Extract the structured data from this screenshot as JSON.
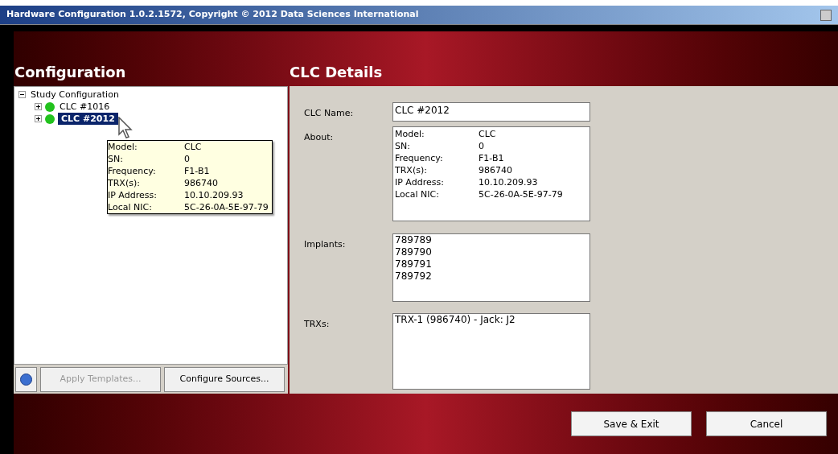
{
  "window": {
    "title": "Hardware Configuration 1.0.2.1572, Copyright © 2012 Data Sciences International"
  },
  "left_panel": {
    "heading": "Configuration",
    "tree": [
      {
        "label": "Study Configuration",
        "expanded": true,
        "selected": false,
        "children": [
          {
            "label": "CLC #1016",
            "expanded": false,
            "selected": false,
            "color": "#22c21e"
          },
          {
            "label": "CLC #2012",
            "expanded": false,
            "selected": true,
            "color": "#22c21e"
          }
        ]
      }
    ],
    "tooltip": [
      {
        "label": "Model:",
        "value": "CLC"
      },
      {
        "label": "SN:",
        "value": "0"
      },
      {
        "label": "Frequency:",
        "value": "F1-B1"
      },
      {
        "label": "TRX(s):",
        "value": "986740"
      },
      {
        "label": "IP Address:",
        "value": "10.10.209.93"
      },
      {
        "label": "Local NIC:",
        "value": "5C-26-0A-5E-97-79"
      }
    ],
    "buttons": [
      {
        "label": "Apply Templates...",
        "disabled": true
      },
      {
        "label": "Configure Sources...",
        "disabled": false
      }
    ]
  },
  "details": {
    "heading": "CLC Details",
    "name_label": "CLC Name:",
    "name_value": "CLC #2012",
    "about_label": "About:",
    "about": [
      {
        "label": "Model:",
        "value": "CLC"
      },
      {
        "label": "SN:",
        "value": "0"
      },
      {
        "label": "Frequency:",
        "value": "F1-B1"
      },
      {
        "label": "TRX(s):",
        "value": "986740"
      },
      {
        "label": "IP Address:",
        "value": "10.10.209.93"
      },
      {
        "label": "Local NIC:",
        "value": "5C-26-0A-5E-97-79"
      }
    ],
    "implants_label": "Implants:",
    "implants": [
      "789789",
      "789790",
      "789791",
      "789792"
    ],
    "trxs_label": "TRXs:",
    "trxs": [
      "TRX-1 (986740) - Jack: J2"
    ]
  },
  "footer_buttons": [
    "Save & Exit",
    "Cancel"
  ]
}
